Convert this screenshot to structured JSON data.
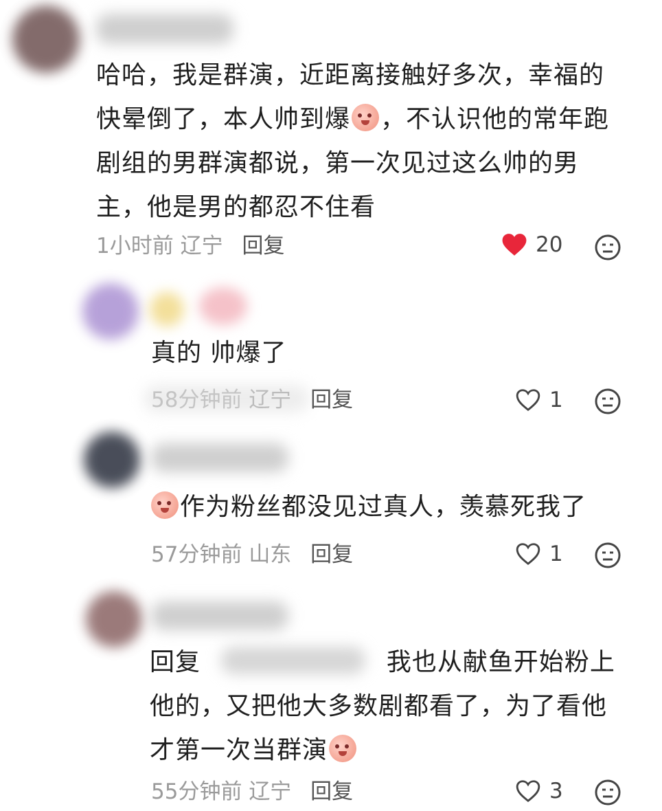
{
  "comments": [
    {
      "text_lines": [
        "哈哈，我是群演，近距离接触好多次，幸福的",
        "快晕倒了，本人帅到爆",
        "，不认识他的常年跑",
        "剧组的男群演都说，第一次见过这么帅的男",
        "主，他是男的都忍不住看"
      ],
      "time": "1小时前",
      "location": "辽宁",
      "reply_label": "回复",
      "likes": "20",
      "liked": true
    },
    {
      "text": "真的 帅爆了",
      "time": "58分钟前",
      "location": "辽宁",
      "reply_label": "回复",
      "likes": "1",
      "liked": false
    },
    {
      "text": "作为粉丝都没见过真人，羡慕死我了",
      "time": "57分钟前",
      "location": "山东",
      "reply_label": "回复",
      "likes": "1",
      "liked": false
    },
    {
      "reply_prefix": "回复",
      "text_lines": [
        "我也从献鱼开始粉上",
        "他的，又把他大多数剧都看了，为了看他",
        "才第一次当群演"
      ],
      "time": "55分钟前",
      "location": "辽宁",
      "reply_label": "回复",
      "likes": "3",
      "liked": false
    }
  ],
  "icons": {
    "like_filled": "heart-filled-icon",
    "like_outline": "heart-outline-icon",
    "emoji": "face-icon",
    "inline_emoji": "peach-emoji-icon"
  },
  "colors": {
    "like_red": "#e8263a",
    "meta_gray": "#9a9a9a"
  }
}
